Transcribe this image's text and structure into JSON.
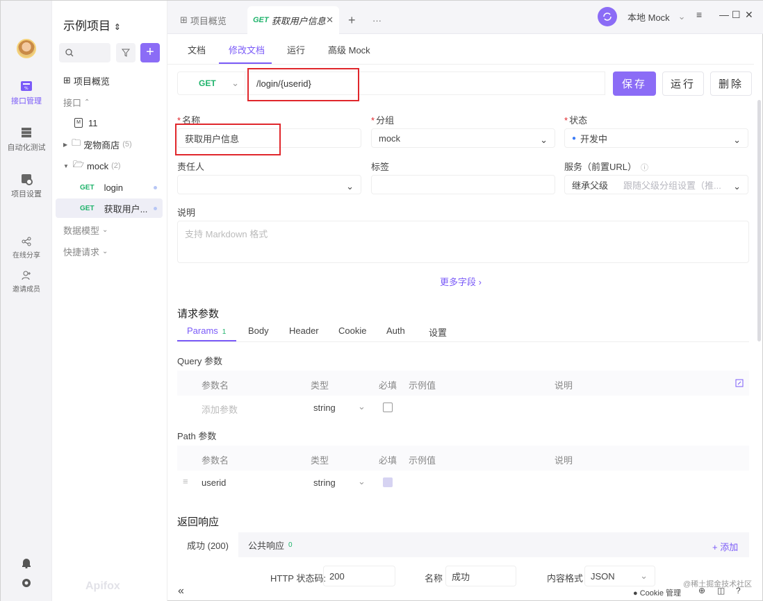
{
  "rail": {
    "items": [
      {
        "label": "接口管理",
        "icon": "api-management-icon"
      },
      {
        "label": "自动化测试",
        "icon": "automation-test-icon"
      },
      {
        "label": "项目设置",
        "icon": "project-settings-icon"
      },
      {
        "label": "在线分享",
        "icon": "share-icon"
      },
      {
        "label": "邀请成员",
        "icon": "invite-member-icon"
      }
    ]
  },
  "tree": {
    "project_title": "示例项目",
    "overview": "项目概览",
    "api_group": "接口",
    "items": [
      {
        "label": "11"
      },
      {
        "label": "宠物商店",
        "count": "(5)"
      },
      {
        "label": "mock",
        "count": "(2)"
      },
      {
        "method": "GET",
        "label": "login"
      },
      {
        "method": "GET",
        "label": "获取用户..."
      }
    ],
    "data_model": "数据模型",
    "quick_request": "快捷请求",
    "brand": "Apifox"
  },
  "topbar": {
    "tab_overview": "项目概览",
    "tab_active_method": "GET",
    "tab_active_label": "获取用户信息",
    "env": "本地 Mock"
  },
  "subtabs": [
    "文档",
    "修改文档",
    "运行",
    "高级 Mock"
  ],
  "url_bar": {
    "method": "GET",
    "path": "/login/{userid}",
    "save": "保存",
    "run": "运行",
    "delete": "删除"
  },
  "form": {
    "name_label": "名称",
    "name_value": "获取用户信息",
    "group_label": "分组",
    "group_value": "mock",
    "status_label": "状态",
    "status_value": "开发中",
    "owner_label": "责任人",
    "tags_label": "标签",
    "service_label": "服务（前置URL）",
    "service_inherit": "继承父级",
    "service_hint": "跟随父级分组设置（推...",
    "desc_label": "说明",
    "desc_placeholder": "支持 Markdown 格式",
    "more_fields": "更多字段"
  },
  "params": {
    "title": "请求参数",
    "tabs": [
      "Params",
      "Body",
      "Header",
      "Cookie",
      "Auth",
      "设置"
    ],
    "params_count": "1",
    "query_label": "Query 参数",
    "path_label": "Path 参数",
    "headers": [
      "参数名",
      "类型",
      "必填",
      "示例值",
      "说明"
    ],
    "query_row": {
      "name_placeholder": "添加参数",
      "type": "string"
    },
    "path_row": {
      "name": "userid",
      "type": "string"
    }
  },
  "response": {
    "title": "返回响应",
    "tab_success": "成功 (200)",
    "tab_common": "公共响应",
    "common_count": "0",
    "add": "+ 添加",
    "http_code_label": "HTTP 状态码:",
    "http_code": "200",
    "name_label": "名称",
    "name_value": "成功",
    "content_type_label": "内容格式",
    "content_type": "JSON"
  },
  "statusbar": {
    "cookie": "Cookie 管理",
    "watermark": "@稀土掘金技术社区"
  }
}
